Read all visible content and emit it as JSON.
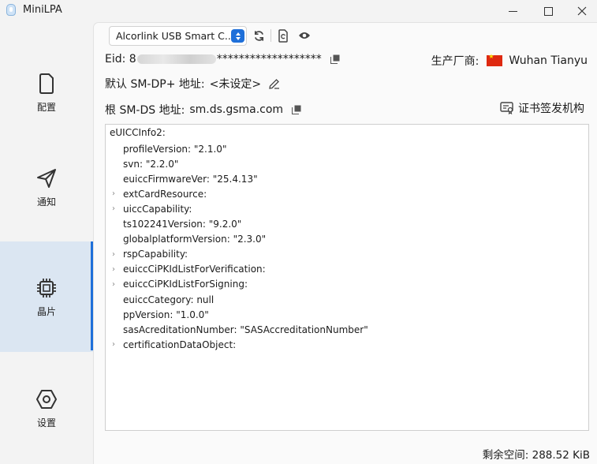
{
  "window": {
    "title": "MiniLPA"
  },
  "sidebar": {
    "items": [
      {
        "label": "配置",
        "icon": "sim-card-icon"
      },
      {
        "label": "通知",
        "icon": "paper-plane-icon"
      },
      {
        "label": "晶片",
        "icon": "chip-icon"
      },
      {
        "label": "设置",
        "icon": "hexagon-gear-icon"
      }
    ],
    "active_index": 2
  },
  "toolbar": {
    "reader": "Alcorlink USB Smart C..."
  },
  "eid": {
    "prefix": "Eid: 8",
    "masked": "*******************"
  },
  "manufacturer": {
    "label": "生产厂商:",
    "value": "Wuhan Tianyu"
  },
  "default_smdp": {
    "label": "默认 SM-DP+ 地址:",
    "value": "<未设定>"
  },
  "root_smds": {
    "label": "根 SM-DS 地址:",
    "value": "sm.ds.gsma.com"
  },
  "cert_button": {
    "label": "证书签发机构"
  },
  "tree": {
    "root": "eUICCInfo2:",
    "rows": [
      {
        "text": "profileVersion: \"2.1.0\"",
        "expandable": false
      },
      {
        "text": "svn: \"2.2.0\"",
        "expandable": false
      },
      {
        "text": "euiccFirmwareVer: \"25.4.13\"",
        "expandable": false
      },
      {
        "text": "extCardResource:",
        "expandable": true
      },
      {
        "text": "uiccCapability:",
        "expandable": true
      },
      {
        "text": "ts102241Version: \"9.2.0\"",
        "expandable": false
      },
      {
        "text": "globalplatformVersion: \"2.3.0\"",
        "expandable": false
      },
      {
        "text": "rspCapability:",
        "expandable": true
      },
      {
        "text": "euiccCiPKIdListForVerification:",
        "expandable": true
      },
      {
        "text": "euiccCiPKIdListForSigning:",
        "expandable": true
      },
      {
        "text": "euiccCategory: null",
        "expandable": false
      },
      {
        "text": "ppVersion: \"1.0.0\"",
        "expandable": false
      },
      {
        "text": "sasAcreditationNumber: \"SASAccreditationNumber\"",
        "expandable": false
      },
      {
        "text": "certificationDataObject:",
        "expandable": true
      }
    ]
  },
  "status": {
    "free_space": "剩余空间: 288.52 KiB"
  },
  "colors": {
    "accent": "#1e6fd9",
    "active_nav_bg": "#dbe6f2"
  }
}
